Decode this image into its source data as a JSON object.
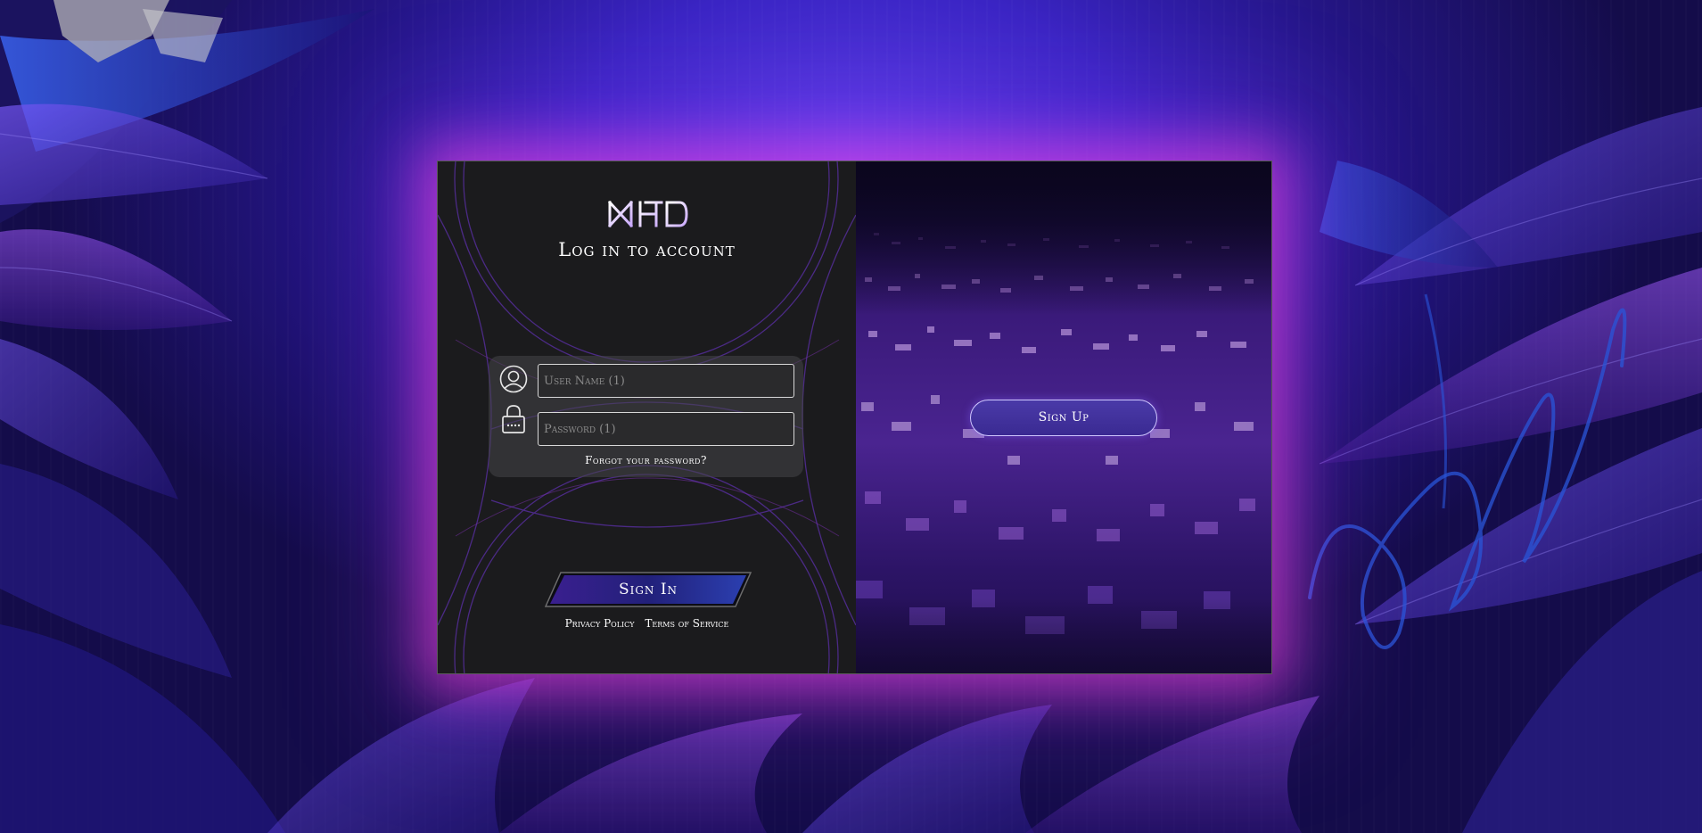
{
  "colors": {
    "bg_primary": "#3b25c4",
    "glow": "#ff46dc",
    "panel_dark": "#1b1b1d",
    "signin_blue": "#2a3aa0",
    "signup_purple": "#3a2a92"
  },
  "login": {
    "logo_text": "MHD",
    "title": "Log in to account",
    "username_placeholder": "User Name (1)",
    "password_placeholder": "Password (1)",
    "forgot_link": "Forgot your password?",
    "signin_label": "Sign In",
    "privacy_link": "Privacy Policy",
    "terms_link": "Terms of Service"
  },
  "signup": {
    "button_label": "Sign Up"
  },
  "icons": {
    "username": "user-icon",
    "password": "lock-icon"
  }
}
